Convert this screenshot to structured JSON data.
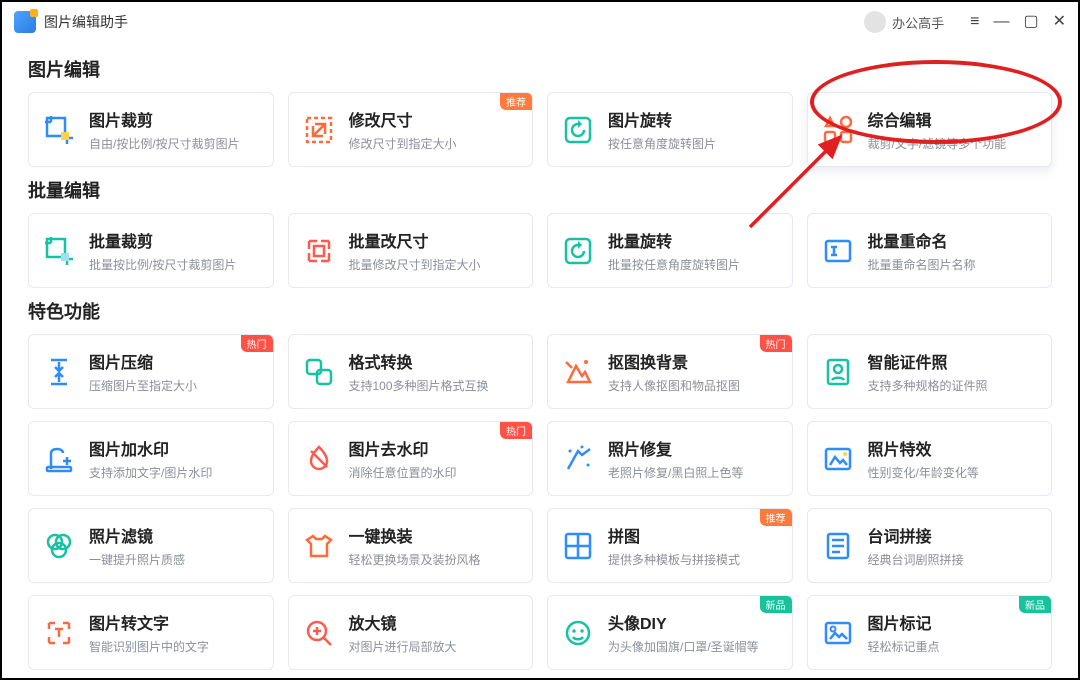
{
  "app": {
    "title": "图片编辑助手"
  },
  "user": {
    "name": "办公高手"
  },
  "badges": {
    "recommend": "推荐",
    "hot": "热门",
    "new": "新品"
  },
  "sections": {
    "edit": {
      "title": "图片编辑",
      "items": [
        {
          "title": "图片裁剪",
          "desc": "自由/按比例/按尺寸裁剪图片",
          "icon": "crop",
          "badge": null
        },
        {
          "title": "修改尺寸",
          "desc": "修改尺寸到指定大小",
          "icon": "resize",
          "badge": "recommend"
        },
        {
          "title": "图片旋转",
          "desc": "按任意角度旋转图片",
          "icon": "rotate",
          "badge": null
        },
        {
          "title": "综合编辑",
          "desc": "裁剪/文字/滤镜等多个功能",
          "icon": "combo",
          "badge": null,
          "highlighted": true
        }
      ]
    },
    "batch": {
      "title": "批量编辑",
      "items": [
        {
          "title": "批量裁剪",
          "desc": "批量按比例/按尺寸裁剪图片",
          "icon": "crop-green",
          "badge": null
        },
        {
          "title": "批量改尺寸",
          "desc": "批量修改尺寸到指定大小",
          "icon": "resize-red",
          "badge": null
        },
        {
          "title": "批量旋转",
          "desc": "批量按任意角度旋转图片",
          "icon": "rotate-green",
          "badge": null
        },
        {
          "title": "批量重命名",
          "desc": "批量重命名图片名称",
          "icon": "rename",
          "badge": null
        }
      ]
    },
    "special": {
      "title": "特色功能",
      "items": [
        {
          "title": "图片压缩",
          "desc": "压缩图片至指定大小",
          "icon": "compress",
          "badge": "hot"
        },
        {
          "title": "格式转换",
          "desc": "支持100多种图片格式互换",
          "icon": "convert",
          "badge": null
        },
        {
          "title": "抠图换背景",
          "desc": "支持人像抠图和物品抠图",
          "icon": "cutout",
          "badge": "hot"
        },
        {
          "title": "智能证件照",
          "desc": "支持多种规格的证件照",
          "icon": "idphoto",
          "badge": null
        },
        {
          "title": "图片加水印",
          "desc": "支持添加文字/图片水印",
          "icon": "watermark-add",
          "badge": null
        },
        {
          "title": "图片去水印",
          "desc": "消除任意位置的水印",
          "icon": "watermark-remove",
          "badge": "hot"
        },
        {
          "title": "照片修复",
          "desc": "老照片修复/黑白照上色等",
          "icon": "repair",
          "badge": null
        },
        {
          "title": "照片特效",
          "desc": "性别变化/年龄变化等",
          "icon": "effects",
          "badge": null
        },
        {
          "title": "照片滤镜",
          "desc": "一键提升照片质感",
          "icon": "filter",
          "badge": null
        },
        {
          "title": "一键换装",
          "desc": "轻松更换场景及装扮风格",
          "icon": "dress",
          "badge": null
        },
        {
          "title": "拼图",
          "desc": "提供多种模板与拼接模式",
          "icon": "collage",
          "badge": "recommend"
        },
        {
          "title": "台词拼接",
          "desc": "经典台词剧照拼接",
          "icon": "subtitle",
          "badge": null
        },
        {
          "title": "图片转文字",
          "desc": "智能识别图片中的文字",
          "icon": "ocr",
          "badge": null
        },
        {
          "title": "放大镜",
          "desc": "对图片进行局部放大",
          "icon": "zoom",
          "badge": null
        },
        {
          "title": "头像DIY",
          "desc": "为头像加国旗/口罩/圣诞帽等",
          "icon": "avatar-diy",
          "badge": "new"
        },
        {
          "title": "图片标记",
          "desc": "轻松标记重点",
          "icon": "annotate",
          "badge": "new"
        }
      ]
    }
  }
}
